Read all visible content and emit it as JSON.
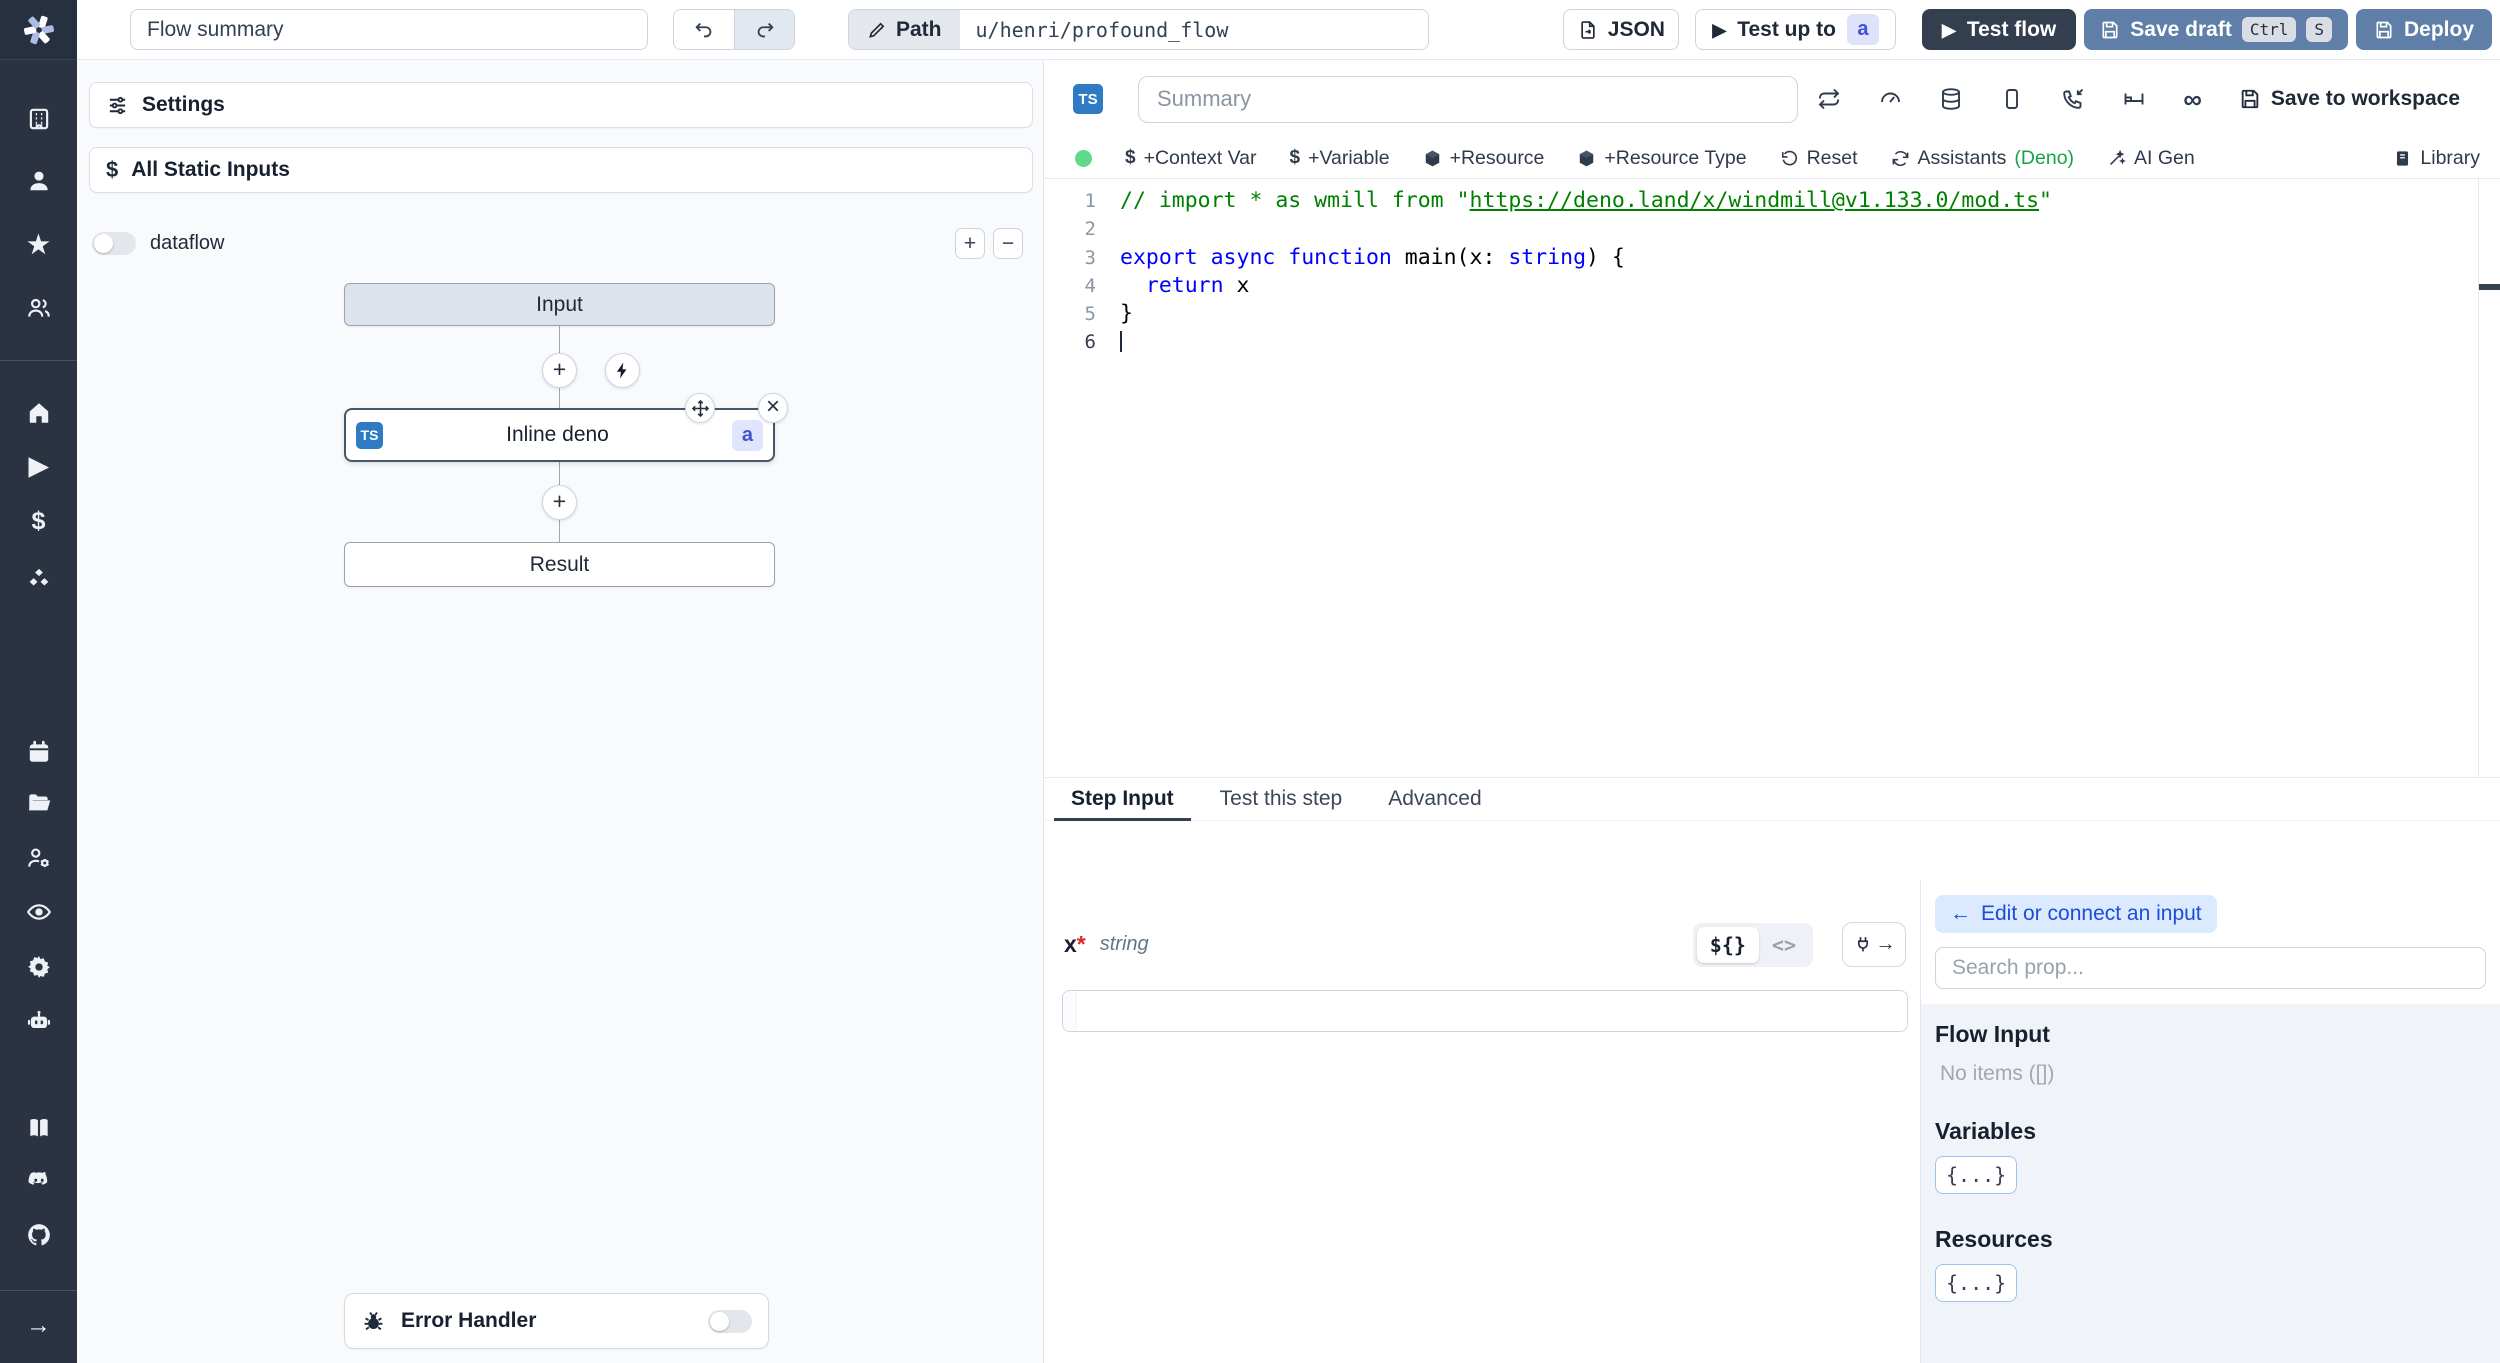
{
  "icons": {
    "star": "★",
    "play": "▶",
    "dollar": "$",
    "arrow_right": "→",
    "back_arrow": "←",
    "infinity": "∞",
    "plus": "+",
    "minus": "−",
    "close": "×",
    "asterisk": "*"
  },
  "sidebar": {
    "icon_names": [
      "windmill-logo",
      "workspace-building",
      "user",
      "favorites-star",
      "groups-users",
      "home",
      "runs-play",
      "variables-dollar",
      "resources-cubes",
      "schedules-calendar",
      "folders-folder",
      "workers-user-cog",
      "audit-eye",
      "settings-gear",
      "ai-bot",
      "docs-book",
      "discord",
      "github",
      "expand-arrow"
    ]
  },
  "topbar": {
    "flow_summary": "Flow summary",
    "path_label": "Path",
    "path_value": "u/henri/profound_flow",
    "json_label": "JSON",
    "test_up_to_label": "Test up to",
    "test_up_to_badge": "a",
    "test_flow_label": "Test flow",
    "save_draft_label": "Save draft",
    "save_draft_kbd": [
      "Ctrl",
      "S"
    ],
    "deploy_label": "Deploy"
  },
  "flow_panel": {
    "settings_label": "Settings",
    "static_inputs_label": "All Static Inputs",
    "dataflow_label": "dataflow",
    "nodes": {
      "input": "Input",
      "step_lang_badge": "TS",
      "step_title": "Inline deno",
      "step_id_badge": "a",
      "result": "Result"
    },
    "error_handler_label": "Error Handler"
  },
  "editor": {
    "lang_badge": "TS",
    "summary_placeholder": "Summary",
    "save_to_workspace_label": "Save to workspace",
    "toolbar": {
      "context_var": "+Context Var",
      "variable": "+Variable",
      "resource": "+Resource",
      "resource_type": "+Resource Type",
      "reset": "Reset",
      "assistants": "Assistants",
      "assistants_lang": "(Deno)",
      "ai_gen": "AI Gen",
      "library": "Library"
    },
    "code": {
      "line_numbers": [
        "1",
        "2",
        "3",
        "4",
        "5",
        "6"
      ],
      "l1a": "// import * as wmill from \"",
      "l1b": "https://deno.land/x/windmill@v1.133.0/mod.ts",
      "l1c": "\"",
      "l3a": "export ",
      "l3b": "async ",
      "l3c": "function ",
      "l3d": "main(x: ",
      "l3e": "string",
      "l3f": ") {",
      "l4a": "  return ",
      "l4b": "x",
      "l5": "}"
    }
  },
  "tabs": {
    "step_input": "Step Input",
    "test_step": "Test this step",
    "advanced": "Advanced"
  },
  "step_input": {
    "arg_name": "x",
    "required_mark": "*",
    "arg_type": "string",
    "expr_toggle": "${}",
    "code_toggle": "<>"
  },
  "props_panel": {
    "edit_connect_label": "Edit or connect an input",
    "search_placeholder": "Search prop...",
    "flow_input_heading": "Flow Input",
    "flow_input_empty": "No items ([])",
    "variables_heading": "Variables",
    "resources_heading": "Resources",
    "object_chip": "{...}"
  }
}
